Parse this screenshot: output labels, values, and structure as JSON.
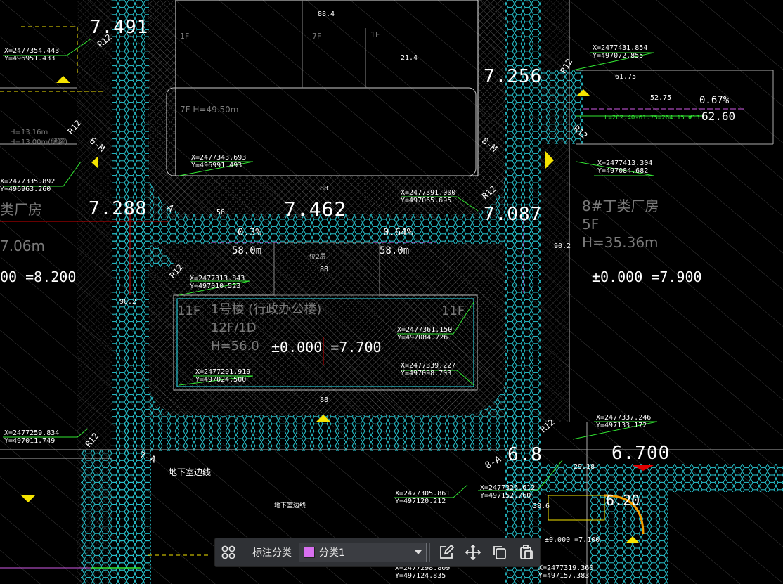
{
  "colors": {
    "accent_cyan": "#27c5d0",
    "yellow": "#f5e400",
    "magenta": "#d05ae6",
    "green": "#32e632",
    "swatch": "#d86ff0"
  },
  "coordinates": [
    {
      "x": "X=2477354.443",
      "y": "Y=496951.433"
    },
    {
      "x": "X=2477431.854",
      "y": "Y=497072.855"
    },
    {
      "x": "X=2477343.693",
      "y": "Y=496991.493"
    },
    {
      "x": "X=2477413.304",
      "y": "Y=497084.682"
    },
    {
      "x": "X=2477335.892",
      "y": "Y=496963.260"
    },
    {
      "x": "X=2477391.000",
      "y": "Y=497065.695"
    },
    {
      "x": "X=2477313.843",
      "y": "Y=497010.523"
    },
    {
      "x": "X=2477361.150",
      "y": "Y=497084.726"
    },
    {
      "x": "X=2477339.227",
      "y": "Y=497098.703"
    },
    {
      "x": "X=2477291.919",
      "y": "Y=497024.500"
    },
    {
      "x": "X=2477259.834",
      "y": "Y=497011.749"
    },
    {
      "x": "X=2477337.246",
      "y": "Y=497133.172"
    },
    {
      "x": "X=2477305.861",
      "y": "Y=497120.212"
    },
    {
      "x": "X=2477326.612",
      "y": "Y=497152.760"
    },
    {
      "x": "X=2477298.809",
      "y": "Y=497124.835"
    },
    {
      "x": "X=2477319.360",
      "y": "Y=497157.383"
    }
  ],
  "elevations": {
    "e7491": "7.491",
    "e7256": "7.256",
    "e7288": "7.288",
    "e7462": "7.462",
    "e7087": "7.087",
    "e6700": "6.700",
    "e68": "6.8",
    "e620": "6.20",
    "e6260": "62.60"
  },
  "zeros": {
    "left": "00 =8.200",
    "right": "±0.000 =7.900",
    "center": "±0.000 =7.700",
    "small": "±0.000 =7.100"
  },
  "slopes": {
    "s1": "0.3%",
    "s1_len": "58.0m",
    "s2": "0.64%",
    "s2_len": "58.0m",
    "s3": "0.67%"
  },
  "dims": {
    "d8814": "88.4",
    "d1f_a": "1F",
    "d7f": "7F",
    "d1f_b": "1F",
    "d214": "21.4",
    "d7f_h": "7F   H=49.50m",
    "d88_a": "88",
    "d88_b": "88",
    "d88_c": "88",
    "d56": "56",
    "d6175": "61.75",
    "d5275": "52.75",
    "d902": "90.2",
    "d902b": "90.2",
    "d386": "38.6",
    "d2918": "29.18",
    "d_l_green": "L=202.40-61.75=264.15 #13"
  },
  "buildings": {
    "office_11f_l": "11F",
    "office_11f_r": "11F",
    "office_name": "1号楼 (行政办公楼)",
    "office_floors": "12F/1D",
    "office_h": "H=56.0",
    "factory_name": "8#丁类厂房",
    "factory_floors": "5F",
    "factory_h": "H=35.36m",
    "left_partial": "类厂房",
    "left_partial_h": "7.06m",
    "left_h1": "H=13.16m",
    "left_h2": "H=13.00m(储罐)",
    "basement_label": "地下室边线",
    "basement_label2": "地下室边线",
    "pos2": "位2层"
  },
  "road_labels": {
    "r12a": "R12",
    "r12b": "R12",
    "r12c": "R12",
    "r12d": "R12",
    "r12e": "R12",
    "r12f": "R12",
    "r12g": "R12",
    "r12h": "R12",
    "a1": "A",
    "a2": "7-A",
    "a3": "8-A",
    "a4": "6-M",
    "a5": "8-M"
  },
  "toolbar": {
    "grid_icon": "grid-icon",
    "label": "标注分类",
    "select_value": "分类1",
    "edit_icon": "edit-icon",
    "move_icon": "move-icon",
    "copy_icon": "copy-icon",
    "paste_icon": "paste-icon"
  }
}
